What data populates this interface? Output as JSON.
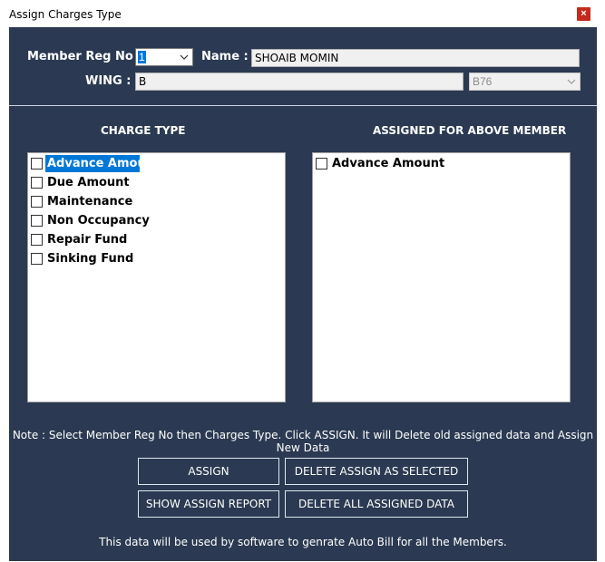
{
  "window": {
    "title": "Assign Charges Type",
    "close_glyph": "×"
  },
  "member": {
    "reg_label": "Member Reg No :",
    "reg_value": "1",
    "name_label": "Name :",
    "name_value": "SHOAIB MOMIN",
    "wing_label": "WING :",
    "wing_value": "B",
    "flat_value": "B76"
  },
  "charge_type": {
    "header": "CHARGE TYPE",
    "items": [
      {
        "label": "Advance Amoun",
        "checked": false,
        "selected": true
      },
      {
        "label": "Due Amount",
        "checked": false,
        "selected": false
      },
      {
        "label": "Maintenance",
        "checked": false,
        "selected": false
      },
      {
        "label": "Non Occupancy",
        "checked": false,
        "selected": false
      },
      {
        "label": "Repair Fund",
        "checked": false,
        "selected": false
      },
      {
        "label": "Sinking Fund",
        "checked": false,
        "selected": false
      }
    ]
  },
  "assigned": {
    "header": "ASSIGNED FOR ABOVE MEMBER",
    "items": [
      {
        "label": "Advance Amount",
        "checked": false
      }
    ]
  },
  "note": "Note : Select Member Reg No then Charges Type. Click ASSIGN. It will Delete old assigned data and Assign New Data",
  "buttons": {
    "assign": "ASSIGN",
    "delete_selected": "DELETE ASSIGN AS SELECTED",
    "show_report": "SHOW ASSIGN REPORT",
    "delete_all": "DELETE ALL ASSIGNED DATA"
  },
  "footer": "This data will be used by software to genrate Auto Bill for all the Members.",
  "colors": {
    "background": "#2b3a52",
    "selection": "#0078d7",
    "close": "#c42b1c"
  }
}
